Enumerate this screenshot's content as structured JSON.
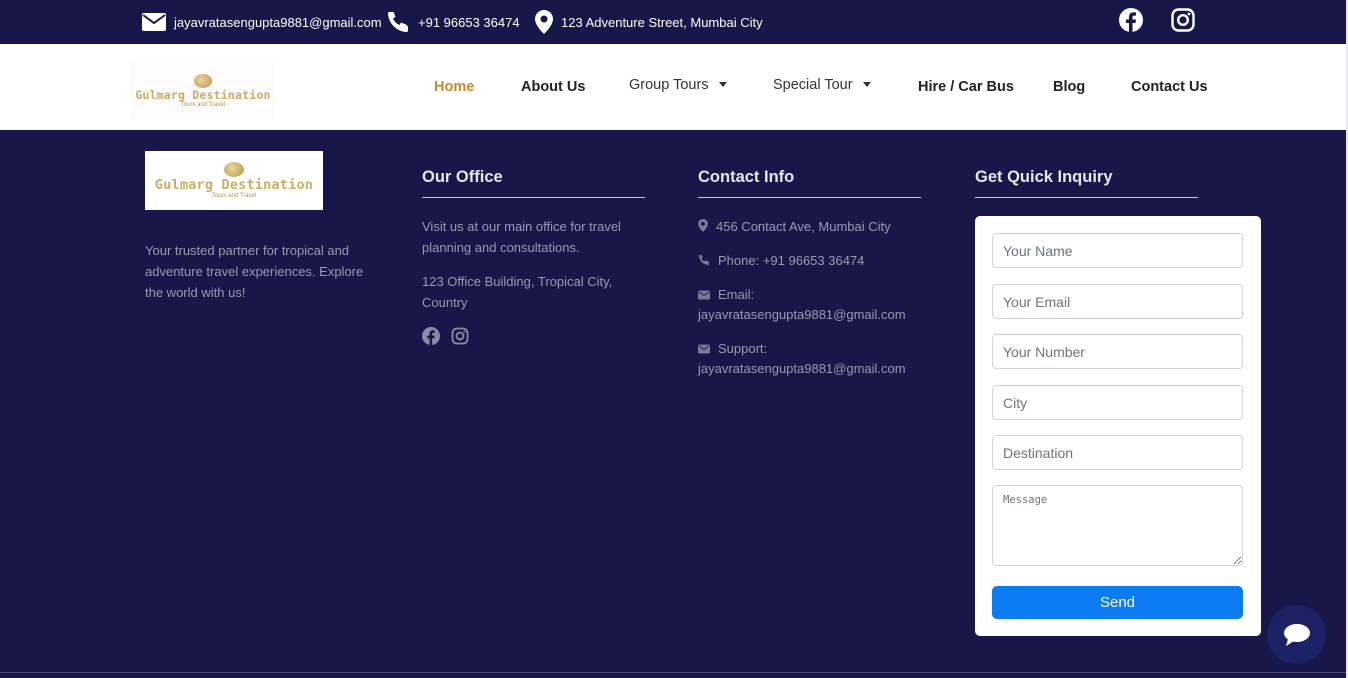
{
  "topbar": {
    "email": "jayavratasengupta9881@gmail.com",
    "phone": "+91 96653 36474",
    "address": "123 Adventure Street, Mumbai City",
    "icons": [
      "envelope-icon",
      "phone-icon",
      "map-pin-icon",
      "facebook-icon",
      "instagram-icon"
    ]
  },
  "brand": {
    "name": "Gulmarg Destination",
    "tagline": "Tours and Travel",
    "color": "#c9ad64"
  },
  "nav": {
    "home": "Home",
    "about": "About Us",
    "group_tours": "Group Tours",
    "special_tour": "Special Tour",
    "hire": "Hire / Car Bus",
    "blog": "Blog",
    "contact": "Contact Us",
    "active_color": "#c78a2c"
  },
  "footer": {
    "about_text": "Your trusted partner for tropical and adventure travel experiences. Explore the world with us!",
    "office": {
      "title": "Our Office",
      "visit": "Visit us at our main office for travel planning and consultations.",
      "address": "123 Office Building, Tropical City, Country"
    },
    "contact": {
      "title": "Contact Info",
      "address": "456 Contact Ave, Mumbai City",
      "phone": "Phone: +91 96653 36474",
      "email_label": "Email:",
      "email": "jayavratasengupta9881@gmail.com",
      "support_label": "Support:",
      "support": "jayavratasengupta9881@gmail.com"
    },
    "inquiry": {
      "title": "Get Quick Inquiry",
      "name_placeholder": "Your Name",
      "email_placeholder": "Your Email",
      "number_placeholder": "Your Number",
      "city_placeholder": "City",
      "destination_placeholder": "Destination",
      "message_placeholder": "Message",
      "send": "Send"
    }
  },
  "colors": {
    "background": "#17174a",
    "send_button": "#0d7cf2",
    "chat_button": "#1d2266"
  }
}
